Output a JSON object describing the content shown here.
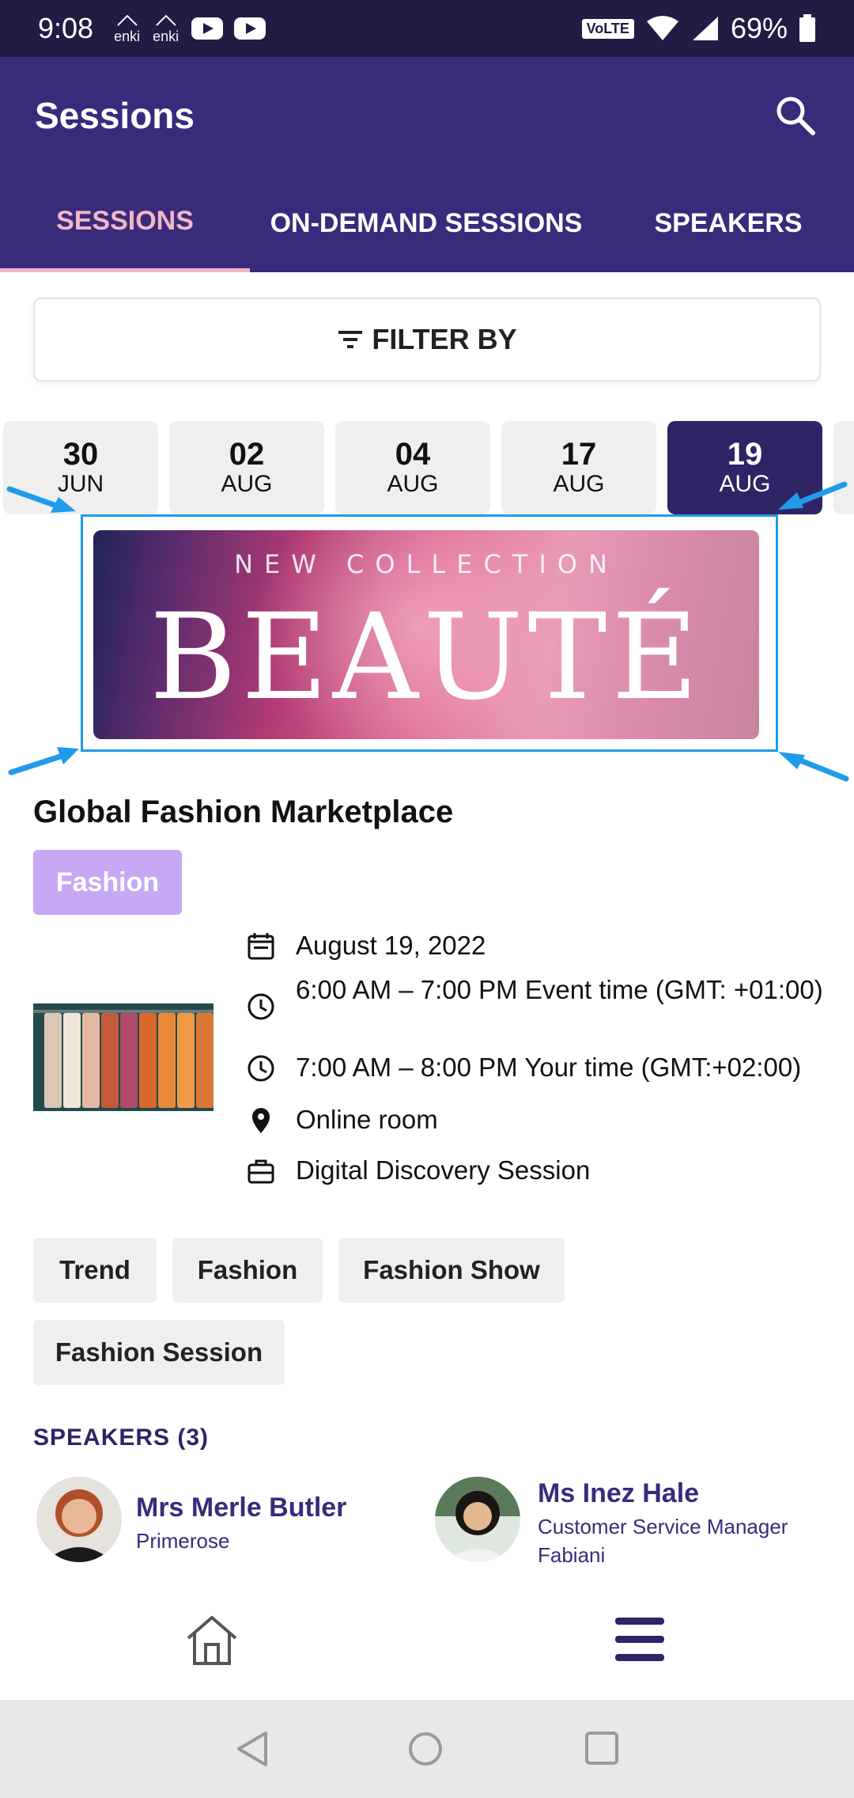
{
  "status": {
    "time": "9:08",
    "enki1": "enki",
    "enki2": "enki",
    "volte": "VoLTE",
    "battery": "69%"
  },
  "appbar": {
    "title": "Sessions"
  },
  "tabs": [
    {
      "label": "SESSIONS"
    },
    {
      "label": "ON-DEMAND SESSIONS"
    },
    {
      "label": "SPEAKERS"
    }
  ],
  "filter": {
    "label": "FILTER BY"
  },
  "dates": [
    {
      "day": "30",
      "month": "JUN"
    },
    {
      "day": "02",
      "month": "AUG"
    },
    {
      "day": "04",
      "month": "AUG"
    },
    {
      "day": "17",
      "month": "AUG"
    },
    {
      "day": "19",
      "month": "AUG"
    }
  ],
  "banner": {
    "line1": "NEW COLLECTION",
    "line2": "BEAUTÉ"
  },
  "session": {
    "title": "Global Fashion Marketplace",
    "category": "Fashion",
    "date": "August 19, 2022",
    "event_time": "6:00 AM – 7:00 PM Event time (GMT: +01:00)",
    "your_time": "7:00 AM – 8:00 PM Your time (GMT:+02:00)",
    "location": "Online room",
    "type": "Digital Discovery Session",
    "tags": [
      "Trend",
      "Fashion",
      "Fashion Show",
      "Fashion Session"
    ]
  },
  "speakers": {
    "header": "SPEAKERS (3)",
    "list": [
      {
        "name": "Mrs Merle Butler",
        "company": "Primerose"
      },
      {
        "name": "Ms Inez Hale",
        "role": "Customer Service Manager",
        "company": "Fabiani"
      }
    ]
  },
  "colors": {
    "primary": "#3a2a7c",
    "status_bar": "#241b45",
    "tab_active": "#f0b8c6",
    "badge": "#c6a8f4",
    "highlight": "#1f9bea"
  }
}
